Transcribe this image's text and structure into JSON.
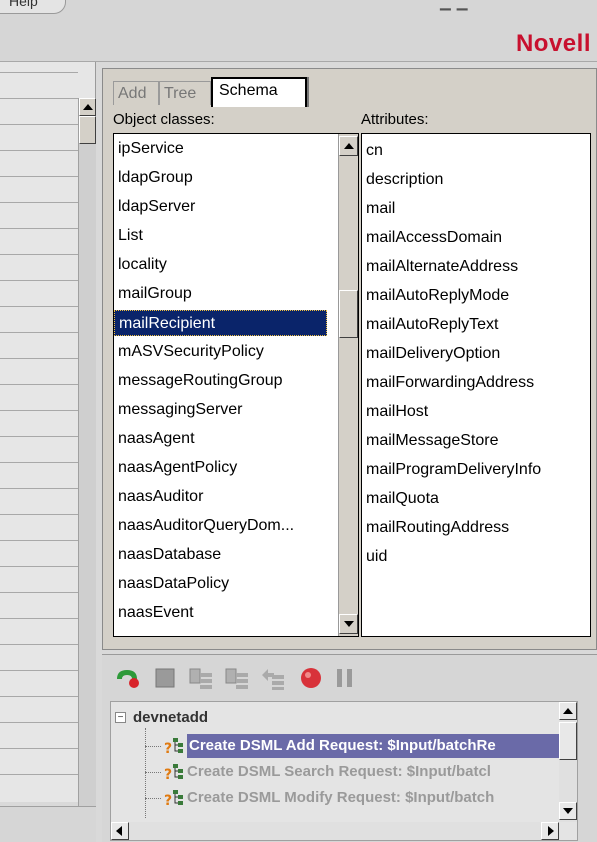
{
  "menu": {
    "help_label": "Help"
  },
  "brand": {
    "name": "Novell",
    "color": "#c8102e"
  },
  "schema_panel": {
    "tabs": [
      {
        "label": "Add",
        "active": false
      },
      {
        "label": "Tree",
        "active": false
      },
      {
        "label": "Schema",
        "active": true
      }
    ],
    "object_classes_label": "Object classes:",
    "attributes_label": "Attributes:",
    "object_classes": [
      "ipService",
      "ldapGroup",
      "ldapServer",
      "List",
      "locality",
      "mailGroup",
      "mailRecipient",
      "mASVSecurityPolicy",
      "messageRoutingGroup",
      "messagingServer",
      "naasAgent",
      "naasAgentPolicy",
      "naasAuditor",
      "naasAuditorQueryDom...",
      "naasDatabase",
      "naasDataPolicy",
      "naasEvent"
    ],
    "selected_object_class": "mailRecipient",
    "attributes": [
      "cn",
      "description",
      "mail",
      "mailAccessDomain",
      "mailAlternateAddress",
      "mailAutoReplyMode",
      "mailAutoReplyText",
      "mailDeliveryOption",
      "mailForwardingAddress",
      "mailHost",
      "mailMessageStore",
      "mailProgramDeliveryInfo",
      "mailQuota",
      "mailRoutingAddress",
      "uid"
    ],
    "selection_color": "#0a246a"
  },
  "toolbar": {
    "icons": [
      "run-icon",
      "stop-icon",
      "step-into-icon",
      "step-over-icon",
      "step-out-icon",
      "record-icon",
      "pause-icon"
    ]
  },
  "tree": {
    "root_label": "devnetadd",
    "expander_symbol": "−",
    "items": [
      {
        "label": "Create DSML Add Request: $Input/batchRe",
        "selected": true
      },
      {
        "label": "Create DSML Search Request: $Input/batcl",
        "selected": false
      },
      {
        "label": "Create DSML Modify Request: $Input/batch",
        "selected": false
      }
    ]
  }
}
